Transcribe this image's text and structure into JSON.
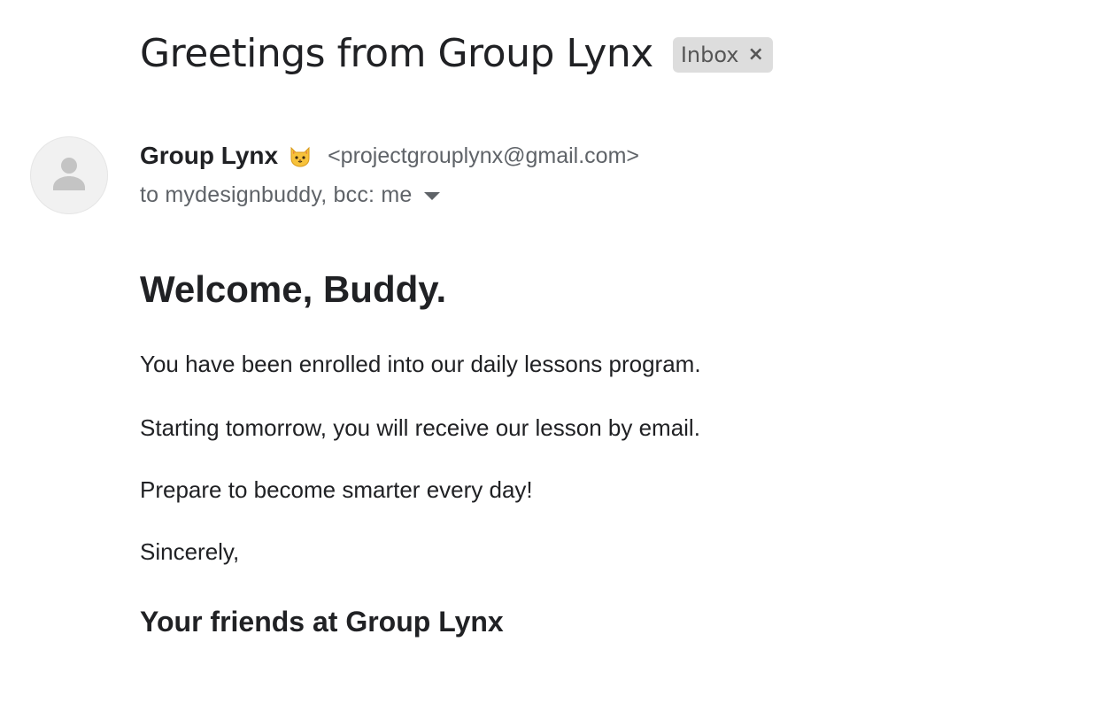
{
  "email": {
    "subject": "Greetings from Group Lynx",
    "label": "Inbox",
    "label_close": "×",
    "sender": {
      "name": "Group Lynx",
      "emoji": "cat-face-emoji",
      "email": "<projectgrouplynx@gmail.com>"
    },
    "recipients": "to mydesignbuddy, bcc: me",
    "body": {
      "greeting": "Welcome, Buddy.",
      "paragraphs": [
        "You have been enrolled into our daily lessons program.",
        "Starting tomorrow, you will receive our lesson by email.",
        "Prepare to become smarter every day!",
        "Sincerely,"
      ],
      "signature": "Your friends at Group Lynx"
    }
  },
  "icons": {
    "avatar": "person-silhouette-icon",
    "details_toggle": "caret-down-icon",
    "label_close": "close-icon"
  },
  "colors": {
    "text_primary": "#202124",
    "text_secondary": "#5f6368",
    "chip_bg": "#dddddd",
    "avatar_bg": "#f1f1f1"
  }
}
